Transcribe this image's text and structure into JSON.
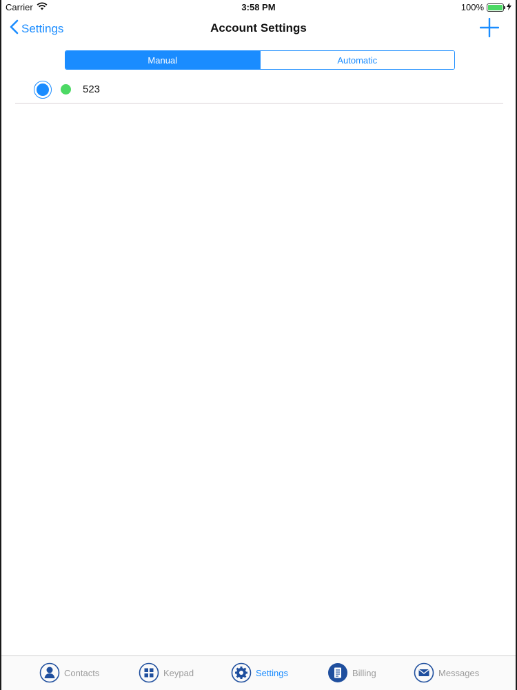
{
  "status_bar": {
    "carrier": "Carrier",
    "time": "3:58 PM",
    "battery": "100%"
  },
  "nav": {
    "back_label": "Settings",
    "title": "Account Settings"
  },
  "segmented": {
    "manual": "Manual",
    "automatic": "Automatic",
    "selected": "Manual"
  },
  "accounts": [
    {
      "label": "523",
      "selected": true,
      "status_color": "#4cd964"
    }
  ],
  "tabs": [
    {
      "label": "Contacts",
      "icon": "contacts-icon",
      "selected": false
    },
    {
      "label": "Keypad",
      "icon": "keypad-icon",
      "selected": false
    },
    {
      "label": "Settings",
      "icon": "gear-icon",
      "selected": true
    },
    {
      "label": "Billing",
      "icon": "billing-icon",
      "selected": false
    },
    {
      "label": "Messages",
      "icon": "mail-icon",
      "selected": false
    }
  ],
  "colors": {
    "accent": "#1a8cff",
    "online": "#4cd964",
    "tab_inactive": "#9a9a9a"
  }
}
